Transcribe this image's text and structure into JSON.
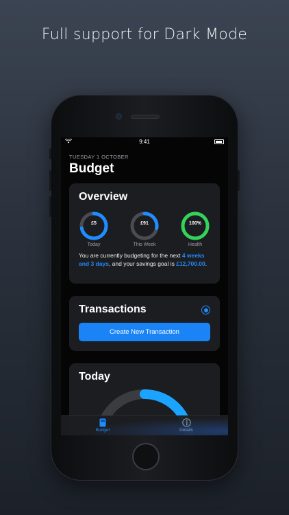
{
  "headline": "Full support for Dark Mode",
  "status_bar": {
    "time": "9:41"
  },
  "header": {
    "date": "TUESDAY 1 OCTOBER",
    "title": "Budget"
  },
  "overview": {
    "title": "Overview",
    "rings": [
      {
        "value": "£5",
        "label": "Today",
        "progress": 0.72,
        "color": "#1f8cff"
      },
      {
        "value": "£91",
        "label": "This Week",
        "progress": 0.28,
        "color": "#1f8cff"
      },
      {
        "value": "100%",
        "label": "Health",
        "progress": 1.0,
        "color": "#33d35a"
      }
    ],
    "text_pre": "You are currently budgeting for the next ",
    "text_period": "4 weeks and 3 days",
    "text_mid": ", and your savings goal is ",
    "text_goal": "£12,700.00",
    "text_end": "."
  },
  "transactions": {
    "title": "Transactions",
    "button_label": "Create New Transaction"
  },
  "today": {
    "title": "Today",
    "progress": 0.55,
    "color": "#1aa3ff"
  },
  "tabbar": {
    "items": [
      {
        "label": "Budget",
        "icon": "budget-icon",
        "active": true,
        "color": "#1f8cff"
      },
      {
        "label": "Details",
        "icon": "info-icon",
        "active": false,
        "color": "#9a9ea6"
      }
    ]
  }
}
